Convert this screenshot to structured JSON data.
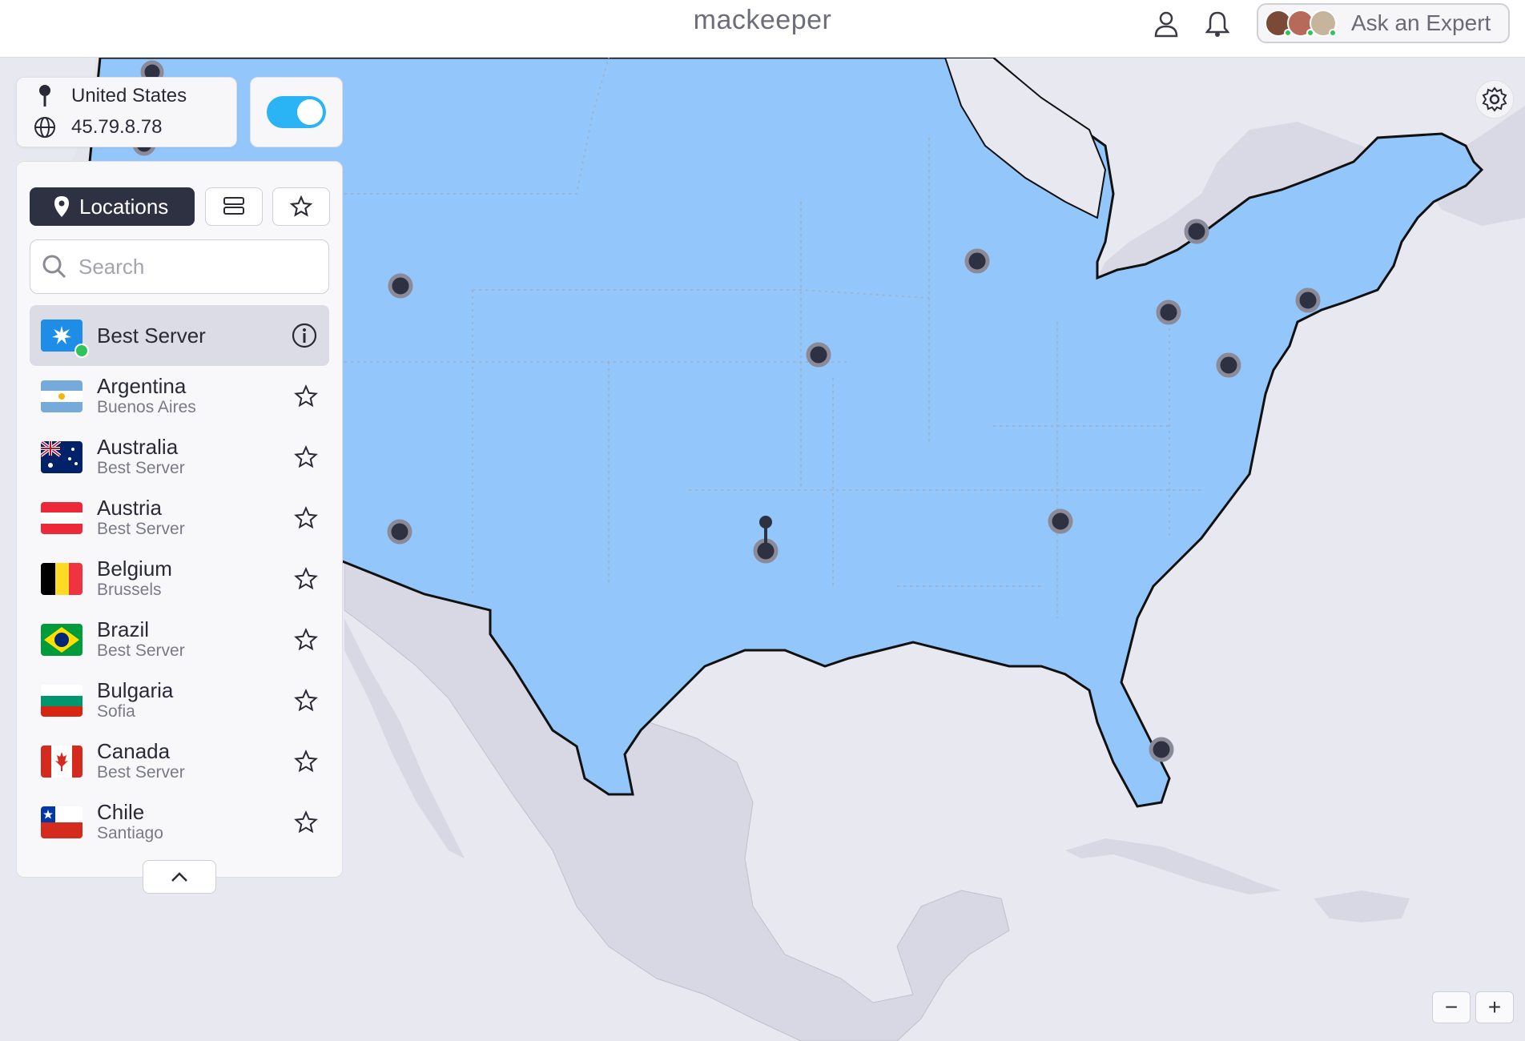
{
  "header": {
    "brand": "mackeeper",
    "ask_expert_label": "Ask an Expert",
    "icons": [
      "user-icon",
      "bell-icon"
    ]
  },
  "connection": {
    "location": "United States",
    "ip": "45.79.8.78",
    "vpn_enabled": true
  },
  "panel": {
    "tab_locations_label": "Locations",
    "search_placeholder": "Search",
    "best_server_label": "Best Server",
    "countries": [
      {
        "name": "Argentina",
        "sub": "Buenos Aires"
      },
      {
        "name": "Australia",
        "sub": "Best Server"
      },
      {
        "name": "Austria",
        "sub": "Best Server"
      },
      {
        "name": "Belgium",
        "sub": "Brussels"
      },
      {
        "name": "Brazil",
        "sub": "Best Server"
      },
      {
        "name": "Bulgaria",
        "sub": "Sofia"
      },
      {
        "name": "Canada",
        "sub": "Best Server"
      },
      {
        "name": "Chile",
        "sub": "Santiago"
      }
    ]
  },
  "map": {
    "zoom_out_label": "−",
    "zoom_in_label": "+",
    "highlight_color": "#93c7fb",
    "land_color": "#d8d8e4",
    "water_color": "#e8e8f0"
  }
}
